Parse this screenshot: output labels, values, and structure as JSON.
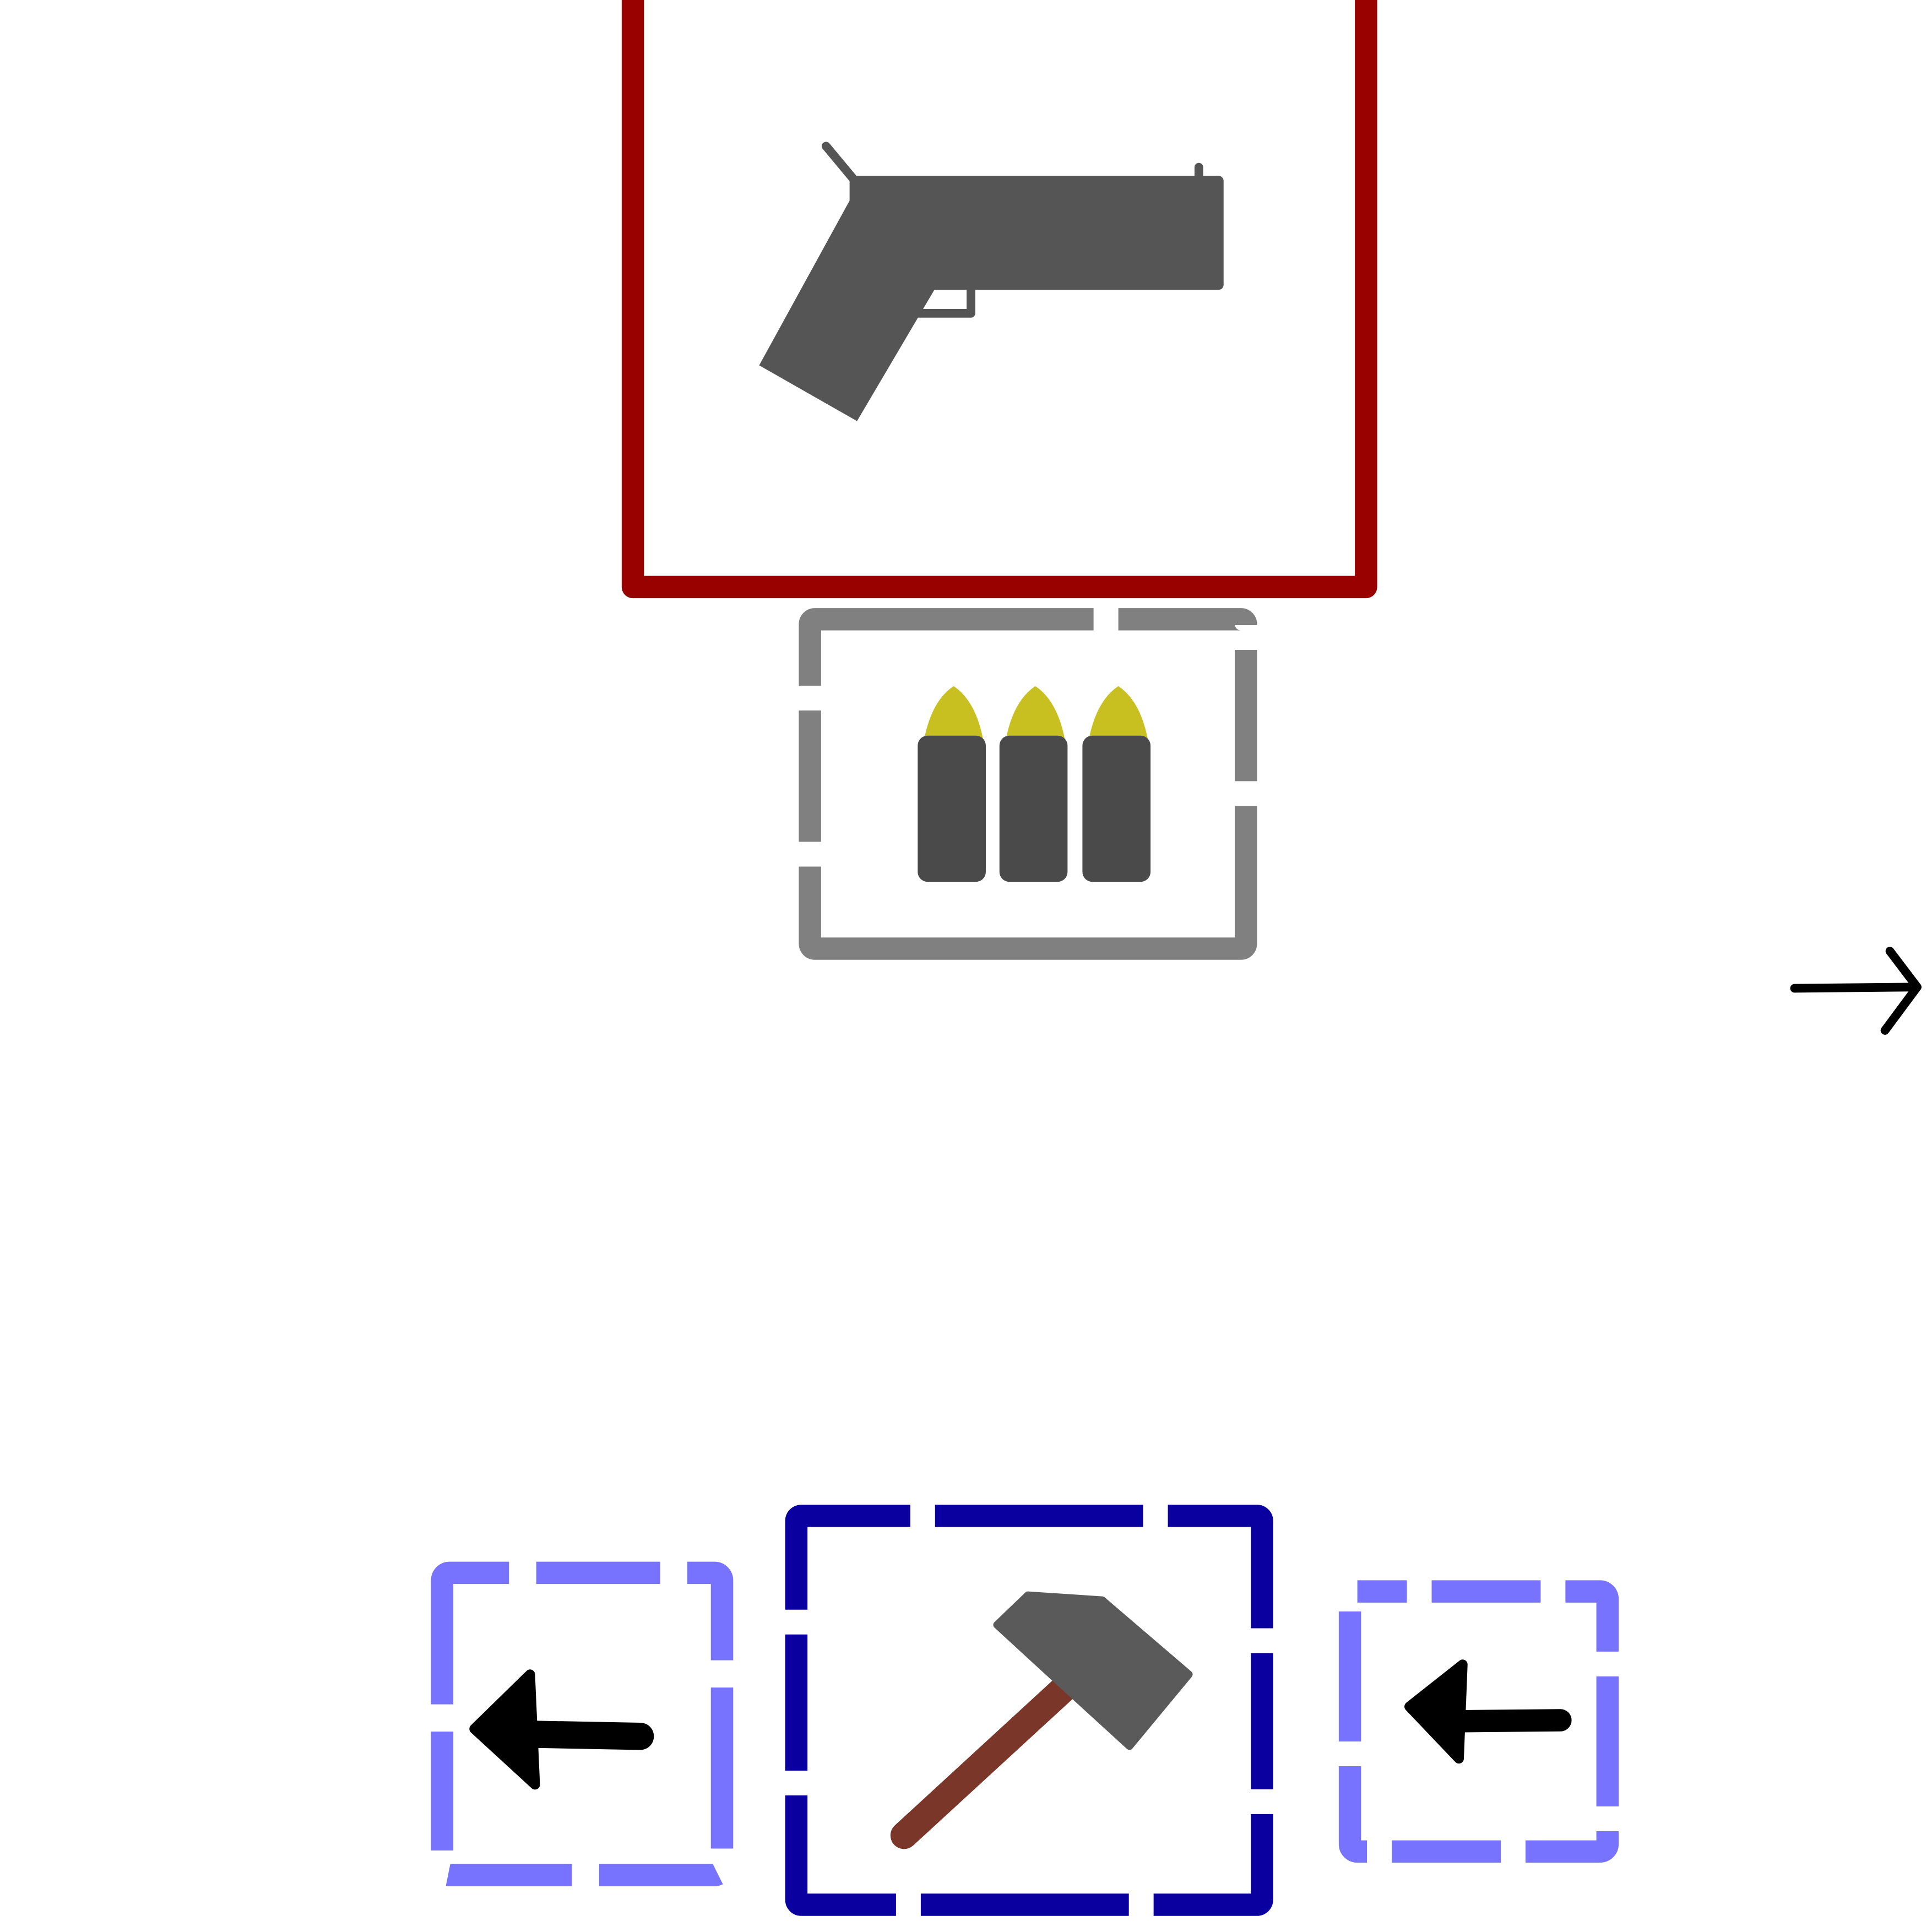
{
  "canvas": {
    "background": "#ffffff"
  },
  "boxes": {
    "weapon_box": {
      "icon": "pistol-icon",
      "border_color": "#990000",
      "border_style": "solid",
      "icon_color": "#555555"
    },
    "ammo_box": {
      "icon": "bullets-icon",
      "border_color": "#808080",
      "border_style": "dashed",
      "bullet_count": 3,
      "casing_color": "#4a4a4a",
      "tip_color": "#c8c020"
    },
    "tool_box": {
      "icon": "hammer-icon",
      "border_color": "#0a00a0",
      "border_style": "dashed",
      "head_color": "#5a5a5a",
      "handle_color": "#7a3628"
    },
    "left_box": {
      "icon": "arrow-left-icon",
      "border_color": "#7773ff",
      "border_style": "dashed"
    },
    "right_box": {
      "icon": "arrow-left-icon",
      "border_color": "#7773ff",
      "border_style": "dashed"
    }
  },
  "edge_arrow": {
    "icon": "arrow-right-icon",
    "color": "#000000"
  }
}
